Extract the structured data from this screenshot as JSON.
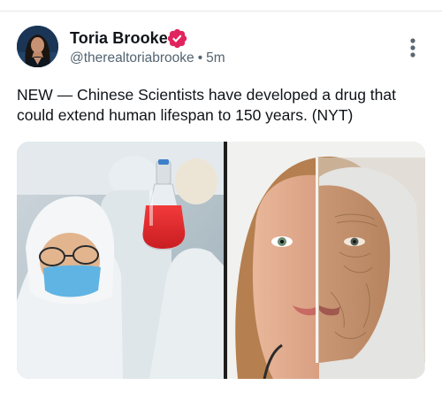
{
  "post": {
    "author_name": "Toria Brooke",
    "handle": "@therealtoriabrooke",
    "separator": "•",
    "time": "5m",
    "text": "NEW — Chinese Scientists have developed a drug that could extend human lifespan to 150 years. (NYT)"
  },
  "icons": {
    "verified": "verified-badge-icon",
    "more": "more-options-icon"
  },
  "colors": {
    "verified_badge": "#e0245e",
    "secondary_text": "#536471",
    "primary_text": "#0f1419",
    "liquid_red": "#e8252b"
  }
}
